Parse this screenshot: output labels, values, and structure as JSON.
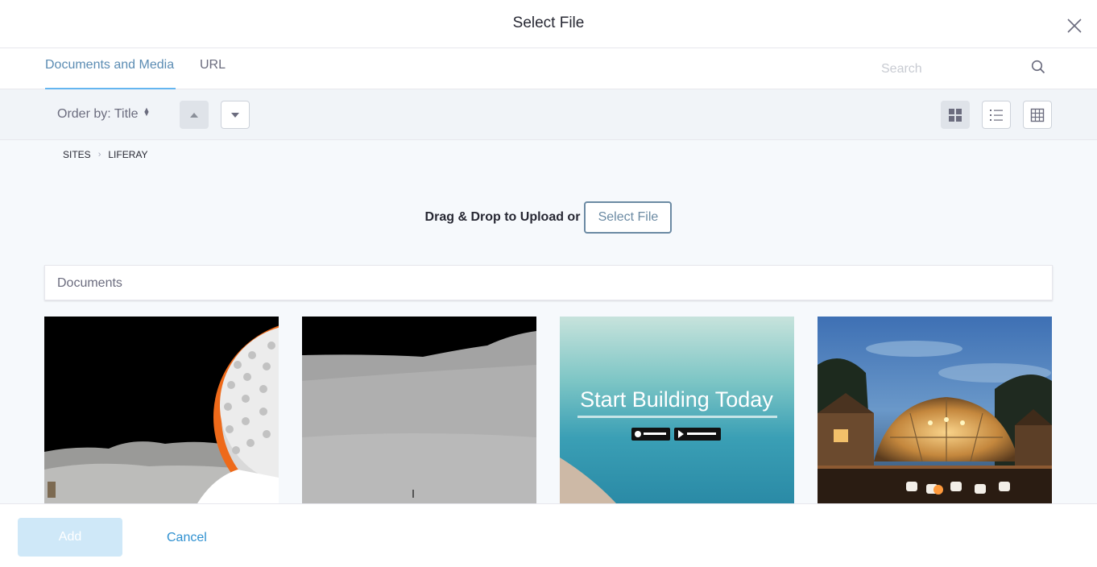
{
  "modal": {
    "title": "Select File"
  },
  "tabs": [
    {
      "label": "Documents and Media",
      "active": true
    },
    {
      "label": "URL",
      "active": false
    }
  ],
  "search": {
    "placeholder": "Search",
    "value": ""
  },
  "toolbar": {
    "order_by_label": "Order by: Title",
    "sort_buttons": [
      "caret-up-icon",
      "caret-down-icon"
    ],
    "view_buttons": [
      "cards-view-icon",
      "list-view-icon",
      "table-view-icon"
    ],
    "active_view": "cards"
  },
  "breadcrumb": [
    "SITES",
    "LIFERAY"
  ],
  "upload": {
    "text": "Drag & Drop to Upload or",
    "button_label": "Select File"
  },
  "documents": {
    "section_title": "Documents",
    "cards": [
      {
        "thumbnail": "moon-golf-ball-image"
      },
      {
        "thumbnail": "lunar-surface-image"
      },
      {
        "thumbnail": "start-building-banner-image",
        "overlay_text": "Start Building Today"
      },
      {
        "thumbnail": "dome-tent-night-image"
      }
    ]
  },
  "footer": {
    "add_label": "Add",
    "cancel_label": "Cancel"
  },
  "colors": {
    "accent": "#65b6f0",
    "link": "#2e90d0",
    "add_disabled": "#cfe8f8"
  }
}
